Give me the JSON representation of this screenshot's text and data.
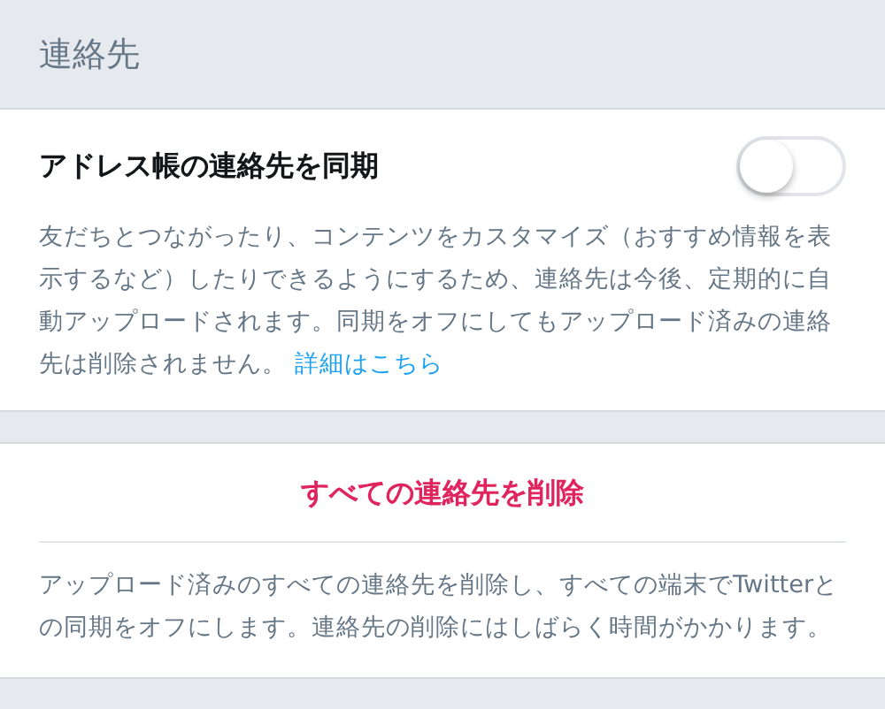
{
  "section_header": {
    "title": "連絡先"
  },
  "sync": {
    "label": "アドレス帳の連絡先を同期",
    "on": false,
    "description": "友だちとつながったり、コンテンツをカスタマイズ（おすすめ情報を表示するなど）したりできるようにするため、連絡先は今後、定期的に自動アップロードされます。同期をオフにしてもアップロード済みの連絡先は削除されません。",
    "link": "詳細はこちら"
  },
  "delete": {
    "button": "すべての連絡先を削除",
    "description": "アップロード済みのすべての連絡先を削除し、すべての端末でTwitterとの同期をオフにします。連絡先の削除にはしばらく時間がかかります。"
  }
}
